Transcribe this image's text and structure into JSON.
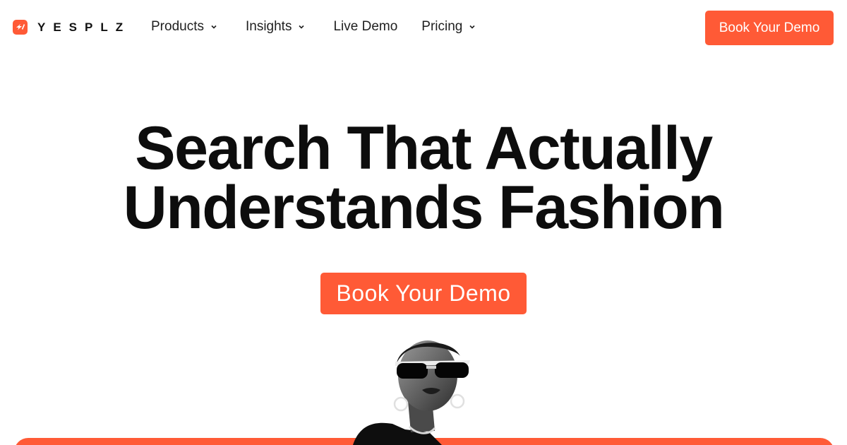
{
  "brand": {
    "name": "YESPLZ",
    "accent": "#ff5a36"
  },
  "nav": {
    "items": [
      {
        "label": "Products",
        "has_dropdown": true
      },
      {
        "label": "Insights",
        "has_dropdown": true
      },
      {
        "label": "Live Demo",
        "has_dropdown": false
      },
      {
        "label": "Pricing",
        "has_dropdown": true
      }
    ],
    "cta_label": "Book Your Demo"
  },
  "hero": {
    "title_line1": "Search That Actually",
    "title_line2": "Understands Fashion",
    "cta_label": "Book Your Demo"
  },
  "icons": [
    "yesplz-logo-icon",
    "chevron-down-icon"
  ]
}
